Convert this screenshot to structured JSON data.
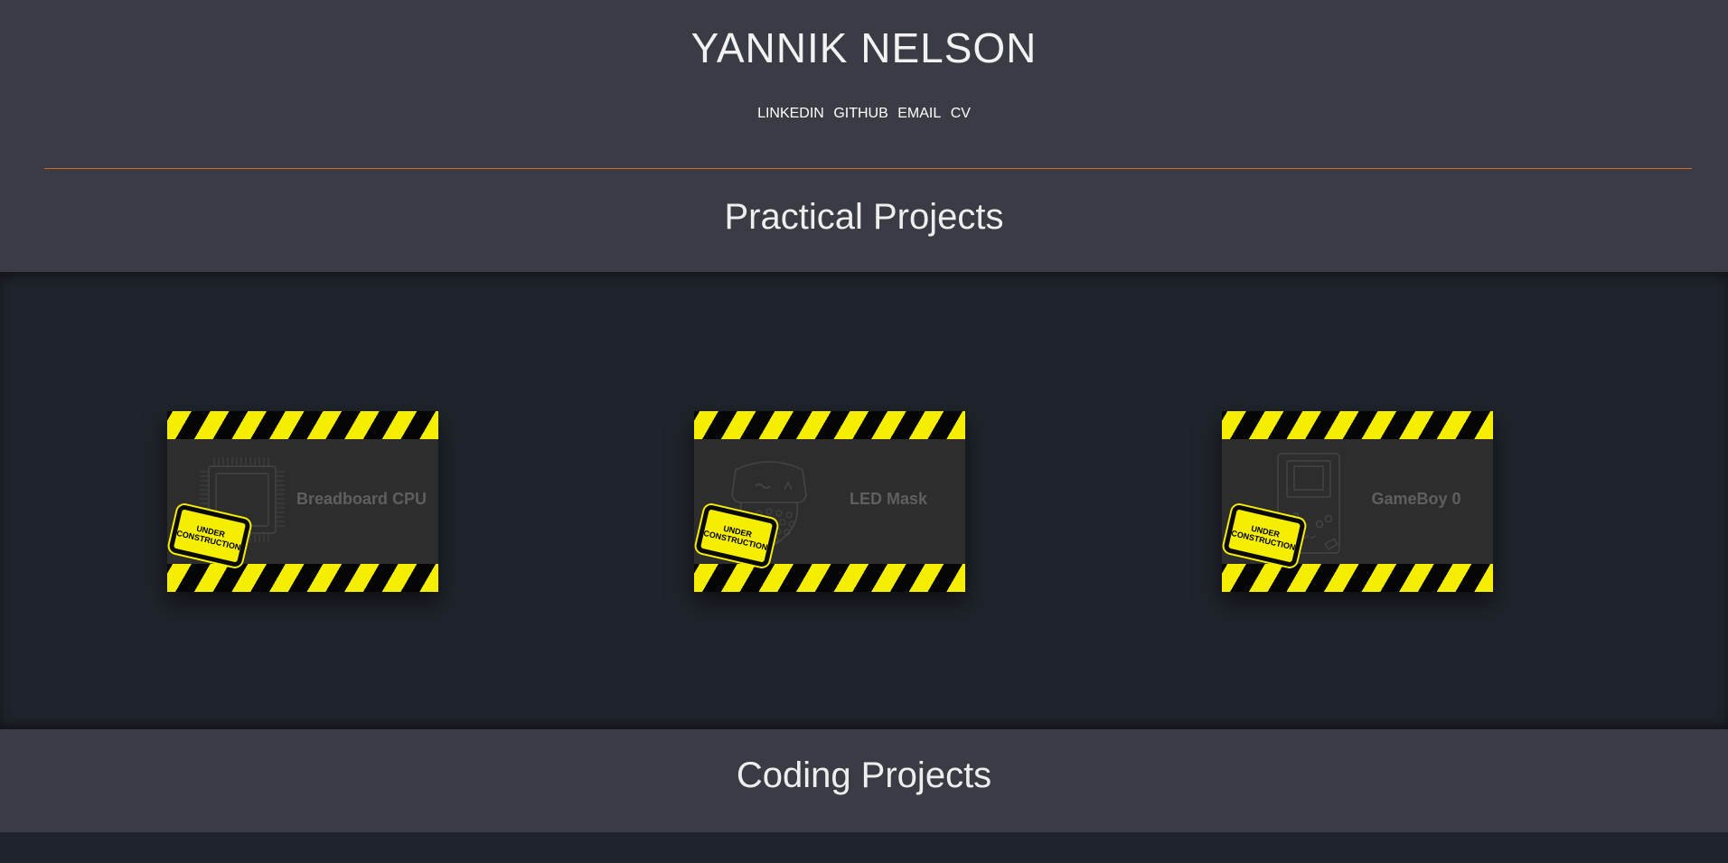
{
  "header": {
    "name": "YANNIK NELSON",
    "nav": [
      {
        "label": "LINKEDIN"
      },
      {
        "label": "GITHUB"
      },
      {
        "label": "EMAIL"
      },
      {
        "label": "CV"
      }
    ]
  },
  "sections": {
    "practical": {
      "title": "Practical Projects"
    },
    "coding": {
      "title": "Coding Projects"
    }
  },
  "projects": [
    {
      "label": "Breadboard CPU",
      "icon": "cpu-chip-icon",
      "badge_line1": "UNDER",
      "badge_line2": "CONSTRUCTION"
    },
    {
      "label": "LED Mask",
      "icon": "led-mask-icon",
      "badge_line1": "UNDER",
      "badge_line2": "CONSTRUCTION"
    },
    {
      "label": "GameBoy 0",
      "icon": "gameboy-icon",
      "badge_line1": "UNDER",
      "badge_line2": "CONSTRUCTION"
    }
  ],
  "colors": {
    "header_bg": "#393c44",
    "band_bg": "#1f232b",
    "accent_line": "#e2661a",
    "hazard_yellow": "#f5ee00",
    "hazard_black": "#050505"
  }
}
